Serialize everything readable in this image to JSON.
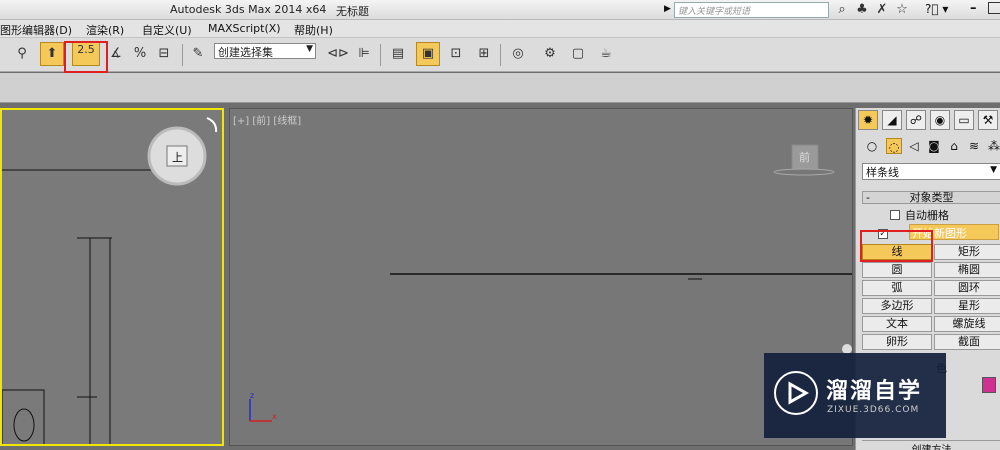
{
  "titlebar": {
    "app_title": "Autodesk 3ds Max  2014 x64",
    "doc_title": "无标题",
    "search_placeholder": "键入关键字或短语"
  },
  "menu": [
    "图形编辑器(D)",
    "渲染(R)",
    "自定义(U)",
    "MAXScript(X)",
    "帮助(H)"
  ],
  "toolbar": {
    "snap_label": "2.5",
    "selection_set_placeholder": "创建选择集"
  },
  "viewport_front": {
    "label": "[+] [前] [线框]",
    "viewcube_label": "前"
  },
  "viewport_left": {
    "viewcube_label": "上"
  },
  "command_panel": {
    "category": "样条线",
    "rollout_object_type": "对象类型",
    "auto_grid_label": "自动栅格",
    "start_new_shape_label": "开始新图形",
    "shapes": [
      [
        "线",
        "矩形"
      ],
      [
        "圆",
        "椭圆"
      ],
      [
        "弧",
        "圆环"
      ],
      [
        "多边形",
        "星形"
      ],
      [
        "文本",
        "螺旋线"
      ],
      [
        "卵形",
        "截面"
      ]
    ],
    "name_color_label": "色",
    "color_swatch": "#d03090",
    "creation_method_label": "创建方法"
  },
  "colors": {
    "active_yellow": "#f5c85a",
    "highlight_red": "#e02020",
    "viewport_border_active": "#f2e600"
  },
  "watermark": {
    "name": "溜溜自学",
    "url": "ZIXUE.3D66.COM"
  },
  "axes": {
    "x": "x",
    "z": "z"
  }
}
